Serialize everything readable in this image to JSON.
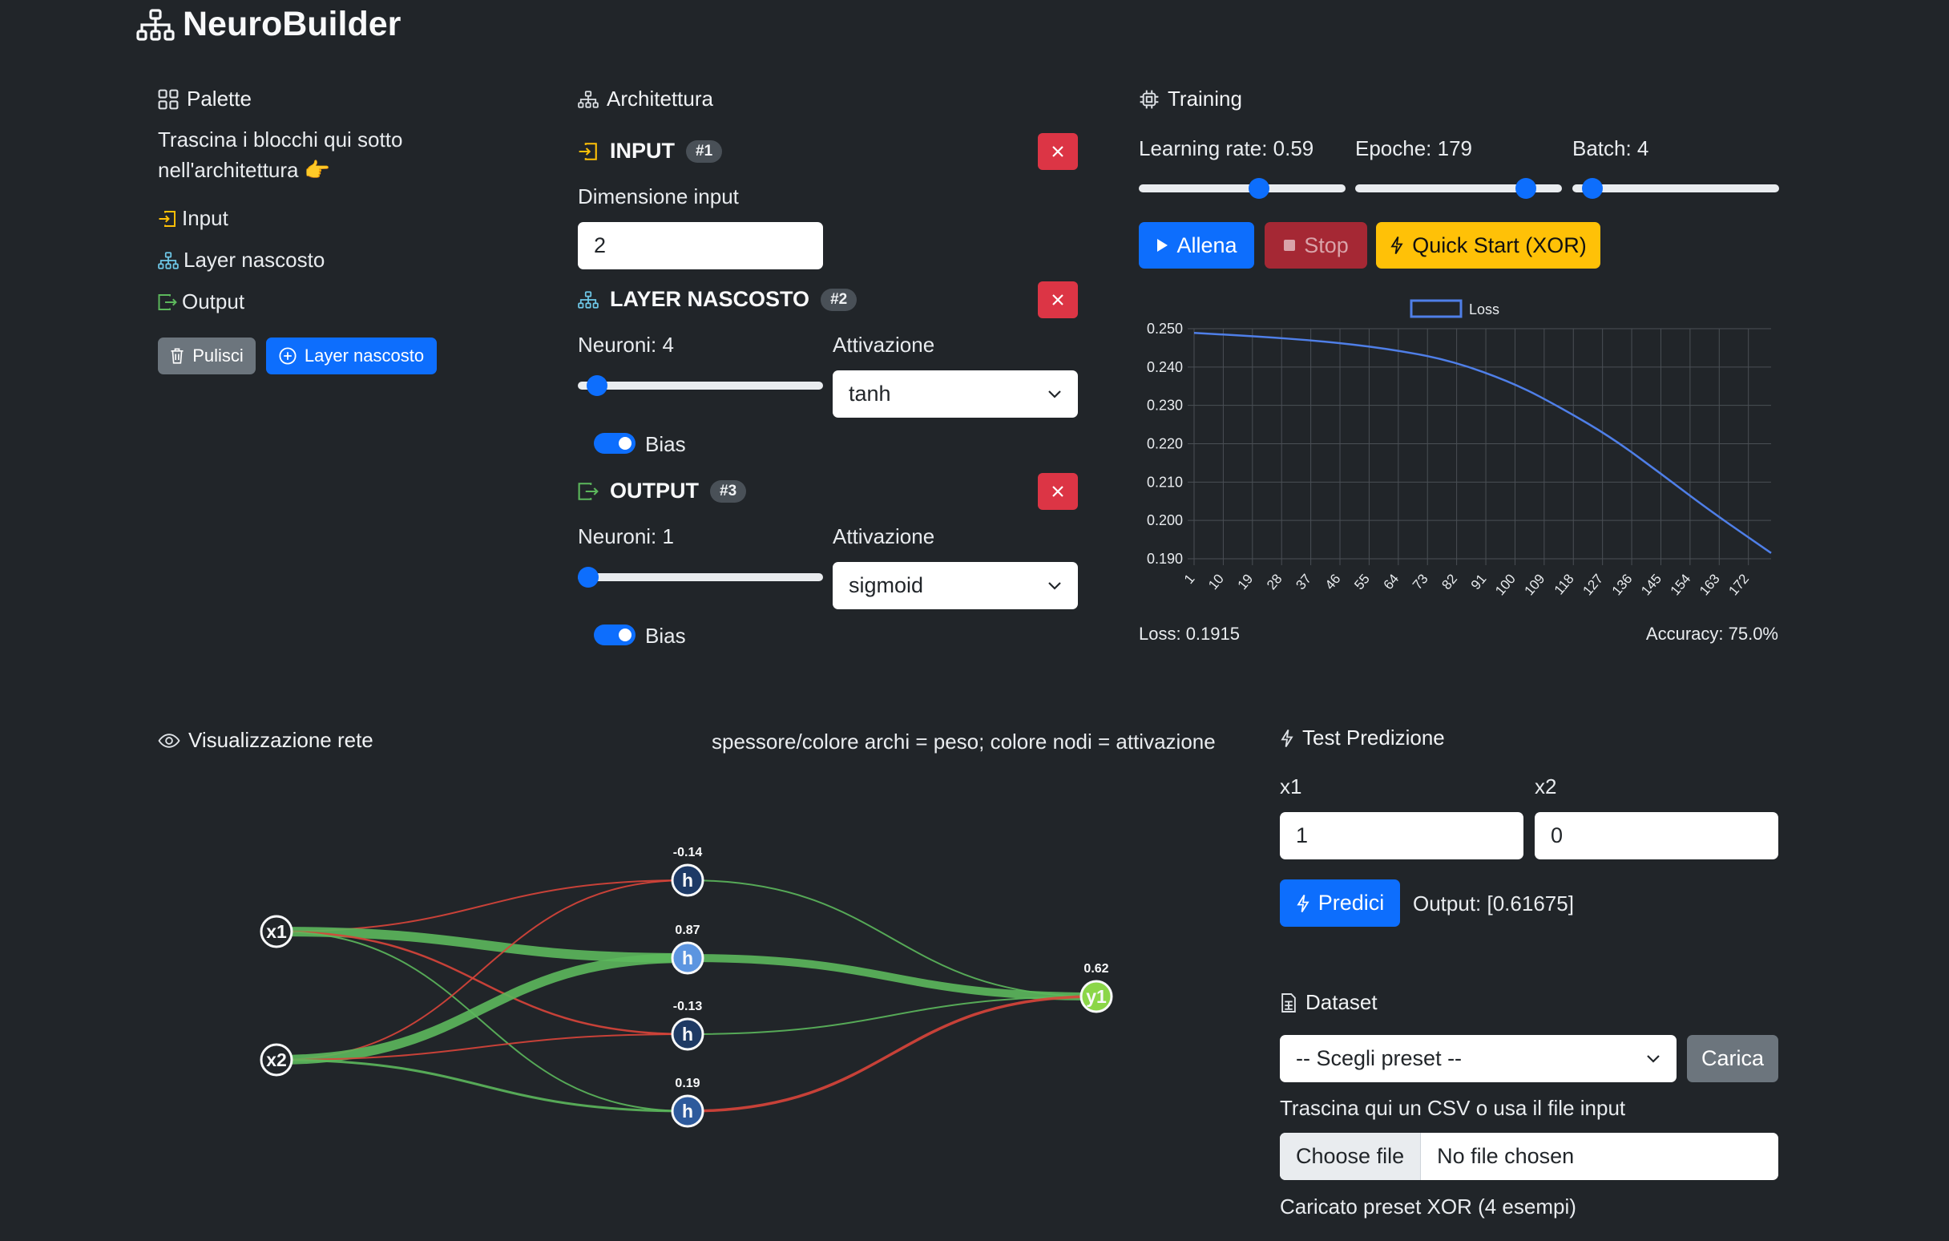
{
  "app": {
    "title": "NeuroBuilder"
  },
  "palette": {
    "title": "Palette",
    "hint": "Trascina i blocchi qui sotto nell'architettura 👉",
    "items": [
      "Input",
      "Layer nascosto",
      "Output"
    ],
    "clear_label": "Pulisci",
    "add_hidden_label": "Layer nascosto"
  },
  "architecture": {
    "title": "Architettura",
    "input": {
      "title": "INPUT",
      "badge": "#1",
      "dim_label": "Dimensione input",
      "dim_value": "2"
    },
    "hidden": {
      "title": "LAYER NASCOSTO",
      "badge": "#2",
      "neurons_label": "Neuroni: 4",
      "neurons_fraction": 0.04,
      "activation_label": "Attivazione",
      "activation_value": "tanh",
      "bias_label": "Bias",
      "bias_on": true
    },
    "output": {
      "title": "OUTPUT",
      "badge": "#3",
      "neurons_label": "Neuroni: 1",
      "neurons_fraction": 0.0,
      "activation_label": "Attivazione",
      "activation_value": "sigmoid",
      "bias_label": "Bias",
      "bias_on": true
    }
  },
  "training": {
    "title": "Training",
    "learning_rate_label": "Learning rate: 0.59",
    "learning_rate_fraction": 0.59,
    "epochs_label": "Epoche: 179",
    "epochs_fraction": 0.86,
    "batch_label": "Batch: 4",
    "batch_fraction": 0.05,
    "train_label": "Allena",
    "stop_label": "Stop",
    "quickstart_label": "Quick Start (XOR)",
    "loss_text": "Loss: 0.1915",
    "accuracy_text": "Accuracy: 75.0%",
    "colors": {
      "line": "#4f7fe8",
      "grid": "#4a4f55"
    }
  },
  "chart_data": {
    "type": "line",
    "legend": "Loss",
    "legend_position": "top-center",
    "grid": true,
    "x_ticks": [
      "1",
      "10",
      "19",
      "28",
      "37",
      "46",
      "55",
      "64",
      "73",
      "82",
      "91",
      "100",
      "109",
      "118",
      "127",
      "136",
      "145",
      "154",
      "163",
      "172"
    ],
    "y_ticks": [
      "0.250",
      "0.240",
      "0.230",
      "0.220",
      "0.210",
      "0.200",
      "0.190"
    ],
    "ylim": [
      0.19,
      0.25
    ],
    "xlim": [
      1,
      179
    ],
    "series": [
      {
        "name": "Loss",
        "x": [
          1,
          20,
          40,
          60,
          80,
          100,
          115,
          130,
          145,
          160,
          179
        ],
        "y": [
          0.2489,
          0.248,
          0.2468,
          0.2449,
          0.2418,
          0.2357,
          0.229,
          0.2215,
          0.2122,
          0.2026,
          0.1915
        ]
      }
    ]
  },
  "network_vis": {
    "title": "Visualizzazione rete",
    "legend": "spessore/colore archi = peso; colore nodi = attivazione",
    "inputs": [
      {
        "label": "x1"
      },
      {
        "label": "x2"
      }
    ],
    "hidden": [
      {
        "label": "h",
        "value": "-0.14",
        "color": "#1d3a66"
      },
      {
        "label": "h",
        "value": "0.87",
        "color": "#5c95e0"
      },
      {
        "label": "h",
        "value": "-0.13",
        "color": "#1e3a64"
      },
      {
        "label": "h",
        "value": "0.19",
        "color": "#2d5a9c"
      }
    ],
    "outputs": [
      {
        "label": "y1",
        "value": "0.62",
        "color": "#8bd648"
      }
    ],
    "edges_in_hidden": [
      {
        "from": 0,
        "to": 0,
        "color": "#d9453a",
        "w": 2
      },
      {
        "from": 0,
        "to": 1,
        "color": "#5cb85c",
        "w": 12
      },
      {
        "from": 0,
        "to": 2,
        "color": "#d9453a",
        "w": 2.5
      },
      {
        "from": 0,
        "to": 3,
        "color": "#5cb85c",
        "w": 2
      },
      {
        "from": 1,
        "to": 0,
        "color": "#d9453a",
        "w": 2
      },
      {
        "from": 1,
        "to": 1,
        "color": "#5cb85c",
        "w": 12
      },
      {
        "from": 1,
        "to": 2,
        "color": "#d9453a",
        "w": 2
      },
      {
        "from": 1,
        "to": 3,
        "color": "#5cb85c",
        "w": 3
      }
    ],
    "edges_hidden_out": [
      {
        "from": 0,
        "color": "#5cb85c",
        "w": 2
      },
      {
        "from": 1,
        "color": "#5cb85c",
        "w": 10
      },
      {
        "from": 2,
        "color": "#5cb85c",
        "w": 2
      },
      {
        "from": 3,
        "color": "#d9453a",
        "w": 3.5
      }
    ]
  },
  "prediction": {
    "title": "Test Predizione",
    "x1_label": "x1",
    "x1_value": "1",
    "x2_label": "x2",
    "x2_value": "0",
    "predict_label": "Predici",
    "output_text": "Output: [0.61675]"
  },
  "dataset": {
    "title": "Dataset",
    "preset_placeholder": "-- Scegli preset --",
    "load_label": "Carica",
    "drop_hint": "Trascina qui un CSV o usa il file input",
    "file_button": "Choose file",
    "file_status": "No file chosen",
    "loaded_text": "Caricato preset XOR (4 esempi)"
  }
}
